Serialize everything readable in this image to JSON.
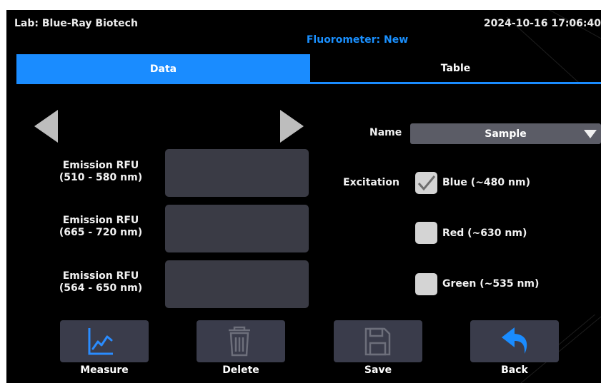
{
  "header": {
    "lab": "Lab: Blue-Ray Biotech",
    "datetime": "2024-10-16 17:06:40",
    "subtitle": "Fluorometer: New"
  },
  "tabs": [
    {
      "label": "Data",
      "active": true
    },
    {
      "label": "Table",
      "active": false
    }
  ],
  "emission_fields": [
    {
      "label_line1": "Emission RFU",
      "label_line2": "(510 - 580 nm)",
      "value": ""
    },
    {
      "label_line1": "Emission RFU",
      "label_line2": "(665 - 720 nm)",
      "value": ""
    },
    {
      "label_line1": "Emission RFU",
      "label_line2": "(564 - 650 nm)",
      "value": ""
    }
  ],
  "name_field": {
    "label": "Name",
    "selected": "Sample"
  },
  "excitation": {
    "label": "Excitation",
    "options": [
      {
        "label": "Blue (~480 nm)",
        "checked": true
      },
      {
        "label": "Red (~630 nm)",
        "checked": false
      },
      {
        "label": "Green (~535 nm)",
        "checked": false
      }
    ]
  },
  "footer": {
    "buttons": [
      {
        "label": "Measure",
        "icon": "line-chart-icon"
      },
      {
        "label": "Delete",
        "icon": "trash-icon"
      },
      {
        "label": "Save",
        "icon": "floppy-disk-icon"
      },
      {
        "label": "Back",
        "icon": "back-arrow-icon"
      }
    ]
  },
  "colors": {
    "accent": "#1a8cff",
    "field_bg": "#3a3b45",
    "button_bg": "#3a3c4b",
    "select_bg": "#5b5c66",
    "checkbox": "#d4d4d4"
  }
}
